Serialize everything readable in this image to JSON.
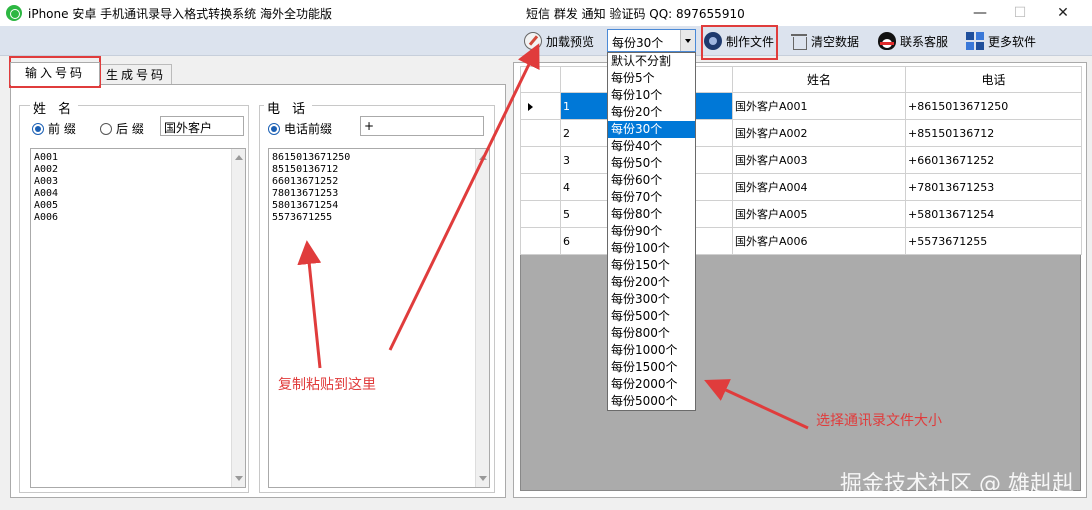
{
  "titlebar": {
    "title": "iPhone 安卓 手机通讯录导入格式转换系统  海外全功能版",
    "right_text": "短信 群发 通知 验证码  QQ:  897655910",
    "minimize": "—",
    "maximize": "☐",
    "close": "✕"
  },
  "toolbar": {
    "preview_label": "加载预览",
    "combo_value": "每份30个",
    "make_file_label": "制作文件",
    "clear_label": "清空数据",
    "contact_label": "联系客服",
    "more_label": "更多软件"
  },
  "tabs": {
    "input": "输入号码",
    "generate": "生成号码"
  },
  "name_group": {
    "title": "姓 名",
    "prefix_label": "前 缀",
    "suffix_label": "后 缀",
    "affix_value": "国外客户",
    "lines": "A001\nA002\nA003\nA004\nA005\nA006"
  },
  "phone_group": {
    "title": "电 话",
    "prefix_label": "电话前缀",
    "prefix_value": "+",
    "lines": "8615013671250\n85150136712\n66013671252\n78013671253\n58013671254\n5573671255"
  },
  "grid": {
    "headers": [
      "",
      "姓名",
      "电话"
    ],
    "rows": [
      [
        "1",
        "国外客户A001",
        "+8615013671250"
      ],
      [
        "2",
        "国外客户A002",
        "+85150136712"
      ],
      [
        "3",
        "国外客户A003",
        "+66013671252"
      ],
      [
        "4",
        "国外客户A004",
        "+78013671253"
      ],
      [
        "5",
        "国外客户A005",
        "+58013671254"
      ],
      [
        "6",
        "国外客户A006",
        "+5573671255"
      ]
    ]
  },
  "dropdown": {
    "options": [
      "默认不分割",
      "每份5个",
      "每份10个",
      "每份20个",
      "每份30个",
      "每份40个",
      "每份50个",
      "每份60个",
      "每份70个",
      "每份80个",
      "每份90个",
      "每份100个",
      "每份150个",
      "每份200个",
      "每份300个",
      "每份500个",
      "每份800个",
      "每份1000个",
      "每份1500个",
      "每份2000个",
      "每份5000个"
    ],
    "selected_index": 4
  },
  "annotations": {
    "paste_here": "复制粘贴到这里",
    "choose_size": "选择通讯录文件大小",
    "accent_color": "#e03c3c"
  },
  "watermark": "掘金技术社区 @ 雄赳赳"
}
